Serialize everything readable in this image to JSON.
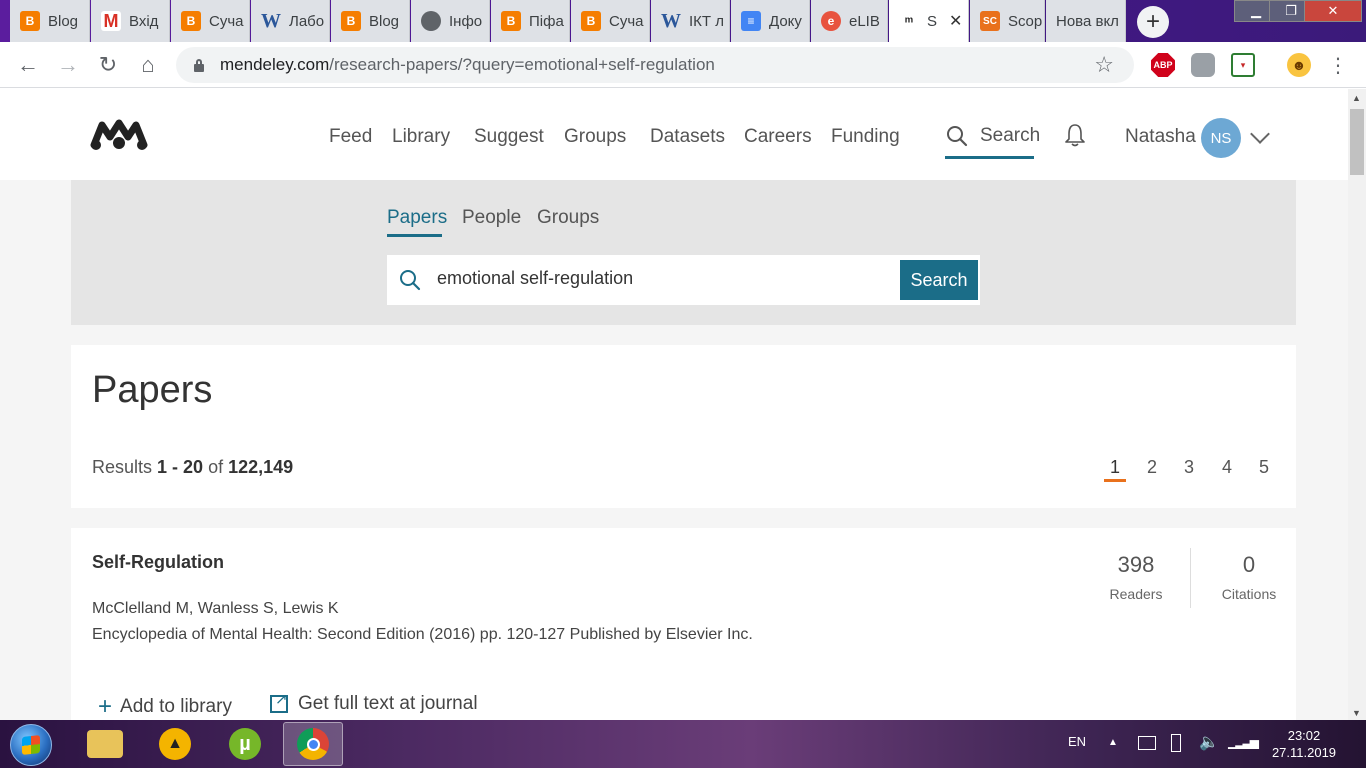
{
  "browser": {
    "tabs": [
      {
        "label": "Blog",
        "favicon": "blogger-icon"
      },
      {
        "label": "Вхід",
        "favicon": "gmail-icon"
      },
      {
        "label": "Суча",
        "favicon": "blogger-icon"
      },
      {
        "label": "Лабо",
        "favicon": "word-icon"
      },
      {
        "label": "Blog",
        "favicon": "blogger-icon"
      },
      {
        "label": "Інфо",
        "favicon": "globe-icon"
      },
      {
        "label": "Піфа",
        "favicon": "blogger-icon"
      },
      {
        "label": "Суча",
        "favicon": "blogger-icon"
      },
      {
        "label": "ІКТ л",
        "favicon": "word-icon"
      },
      {
        "label": "Доку",
        "favicon": "docs-icon"
      },
      {
        "label": "eLIB",
        "favicon": "elibrary-icon"
      },
      {
        "label": "S",
        "favicon": "mendeley-icon",
        "active": true
      },
      {
        "label": "Scop",
        "favicon": "scopus-icon"
      },
      {
        "label": "Нова вкл",
        "favicon": ""
      }
    ],
    "favicon_text": {
      "gmail": "M",
      "word": "W",
      "scopus": "SC"
    },
    "url_host": "mendeley.com",
    "url_path": "/research-papers/?query=emotional+self-regulation",
    "extensions": [
      "abp-icon",
      "mask-icon",
      "calendar-icon",
      "emoji-icon"
    ],
    "abp_text": "ABP"
  },
  "nav": {
    "links": [
      "Feed",
      "Library",
      "Suggest",
      "Groups",
      "Datasets",
      "Careers",
      "Funding"
    ],
    "search_label": "Search",
    "user_name": "Natasha",
    "avatar_initials": "NS"
  },
  "search": {
    "tabs": [
      "Papers",
      "People",
      "Groups"
    ],
    "active_tab": "Papers",
    "query": "emotional self-regulation",
    "button_label": "Search"
  },
  "results": {
    "heading": "Papers",
    "prefix": "Results ",
    "range": "1 - 20",
    "of": " of ",
    "total": "122,149",
    "pages": [
      "1",
      "2",
      "3",
      "4",
      "5"
    ],
    "current_page": "1"
  },
  "papers": [
    {
      "title": "Self-Regulation",
      "authors": "McClelland M, Wanless S, Lewis K",
      "source": "Encyclopedia of Mental Health: Second Edition (2016) pp. 120-127 Published by Elsevier Inc.",
      "readers_value": "398",
      "readers_label": "Readers",
      "citations_value": "0",
      "citations_label": "Citations",
      "add_label": "Add to library",
      "fulltext_label": "Get full text at journal"
    }
  ],
  "taskbar": {
    "apps": [
      "file-explorer-icon",
      "aimp-icon",
      "utorrent-icon",
      "chrome-icon"
    ],
    "utorrent_text": "µ",
    "language": "EN",
    "time": "23:02",
    "date": "27.11.2019"
  },
  "colors": {
    "accent": "#1b6d88",
    "pager_accent": "#e9711c",
    "avatar": "#6da8d4"
  }
}
